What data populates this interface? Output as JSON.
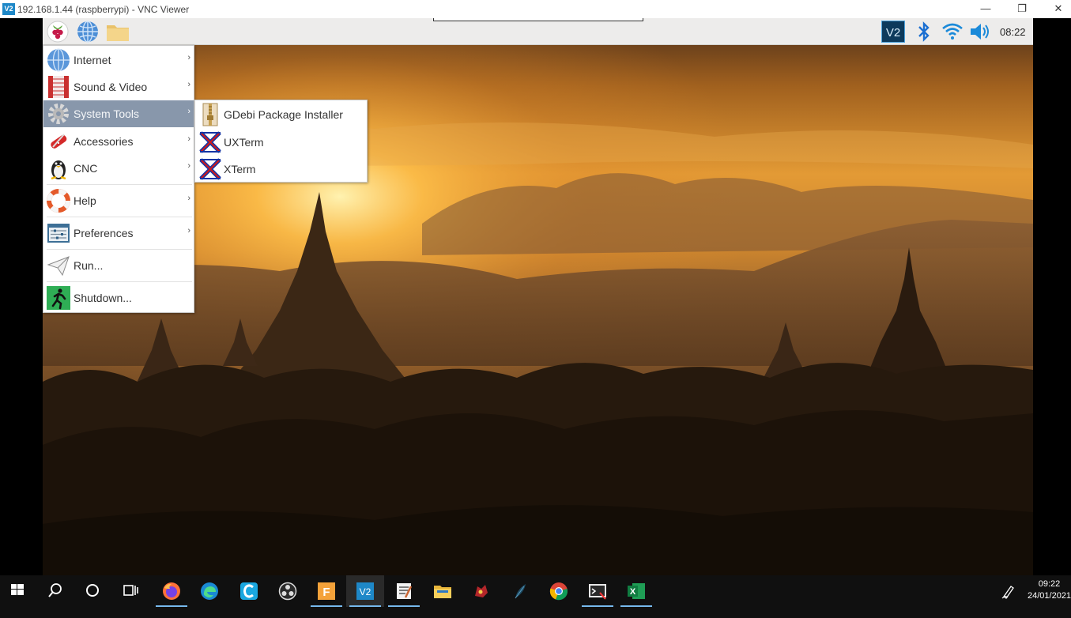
{
  "vnc_window": {
    "title": "192.168.1.44 (raspberrypi) - VNC Viewer",
    "logo_text": "V2",
    "controls": {
      "minimize": "—",
      "restore": "❐",
      "close": "✕"
    }
  },
  "pi_panel": {
    "launchers": [
      "raspberry-menu-icon",
      "web-browser-icon",
      "file-manager-icon"
    ],
    "tray": [
      "vnc-server-icon",
      "bluetooth-icon",
      "wifi-icon",
      "volume-icon"
    ],
    "vnc_tray_text": "V2",
    "clock": "08:22"
  },
  "main_menu": {
    "items": [
      {
        "label": "Internet",
        "icon": "globe-icon",
        "submenu": true
      },
      {
        "label": "Sound & Video",
        "icon": "film-icon",
        "submenu": true
      },
      {
        "label": "System Tools",
        "icon": "gear-icon",
        "submenu": true,
        "active": true
      },
      {
        "label": "Accessories",
        "icon": "swiss-knife-icon",
        "submenu": true
      },
      {
        "label": "CNC",
        "icon": "penguin-icon",
        "submenu": true
      },
      {
        "label": "Help",
        "icon": "lifebuoy-icon",
        "submenu": true
      },
      {
        "label": "Preferences",
        "icon": "sliders-icon",
        "submenu": true
      },
      {
        "label": "Run...",
        "icon": "paper-plane-icon",
        "submenu": false
      },
      {
        "label": "Shutdown...",
        "icon": "exit-icon",
        "submenu": false
      }
    ],
    "arrow": "›"
  },
  "system_tools_submenu": {
    "items": [
      {
        "label": "GDebi Package Installer",
        "icon": "package-icon"
      },
      {
        "label": "UXTerm",
        "icon": "x-terminal-icon"
      },
      {
        "label": "XTerm",
        "icon": "x-terminal-icon"
      }
    ]
  },
  "taskbar": {
    "apps": [
      "windows-start-icon",
      "search-icon",
      "cortana-icon",
      "task-view-icon",
      "firefox-icon",
      "edge-icon",
      "ccleaner-icon",
      "obs-icon",
      "fusion-icon",
      "vnc-viewer-icon",
      "notepad-icon",
      "file-explorer-icon",
      "game-icon",
      "feather-icon",
      "chrome-icon",
      "screen-capture-icon",
      "excel-icon"
    ],
    "fusion_text": "F",
    "vnc_text": "V2",
    "excel_text": "X",
    "clock_time": "09:22",
    "clock_date": "24/01/2021"
  },
  "colors": {
    "menu_highlight": "#8897ab",
    "panel_bg": "#edeceb",
    "taskbar_bg": "#101010",
    "vnc_blue": "#1e88c8"
  }
}
